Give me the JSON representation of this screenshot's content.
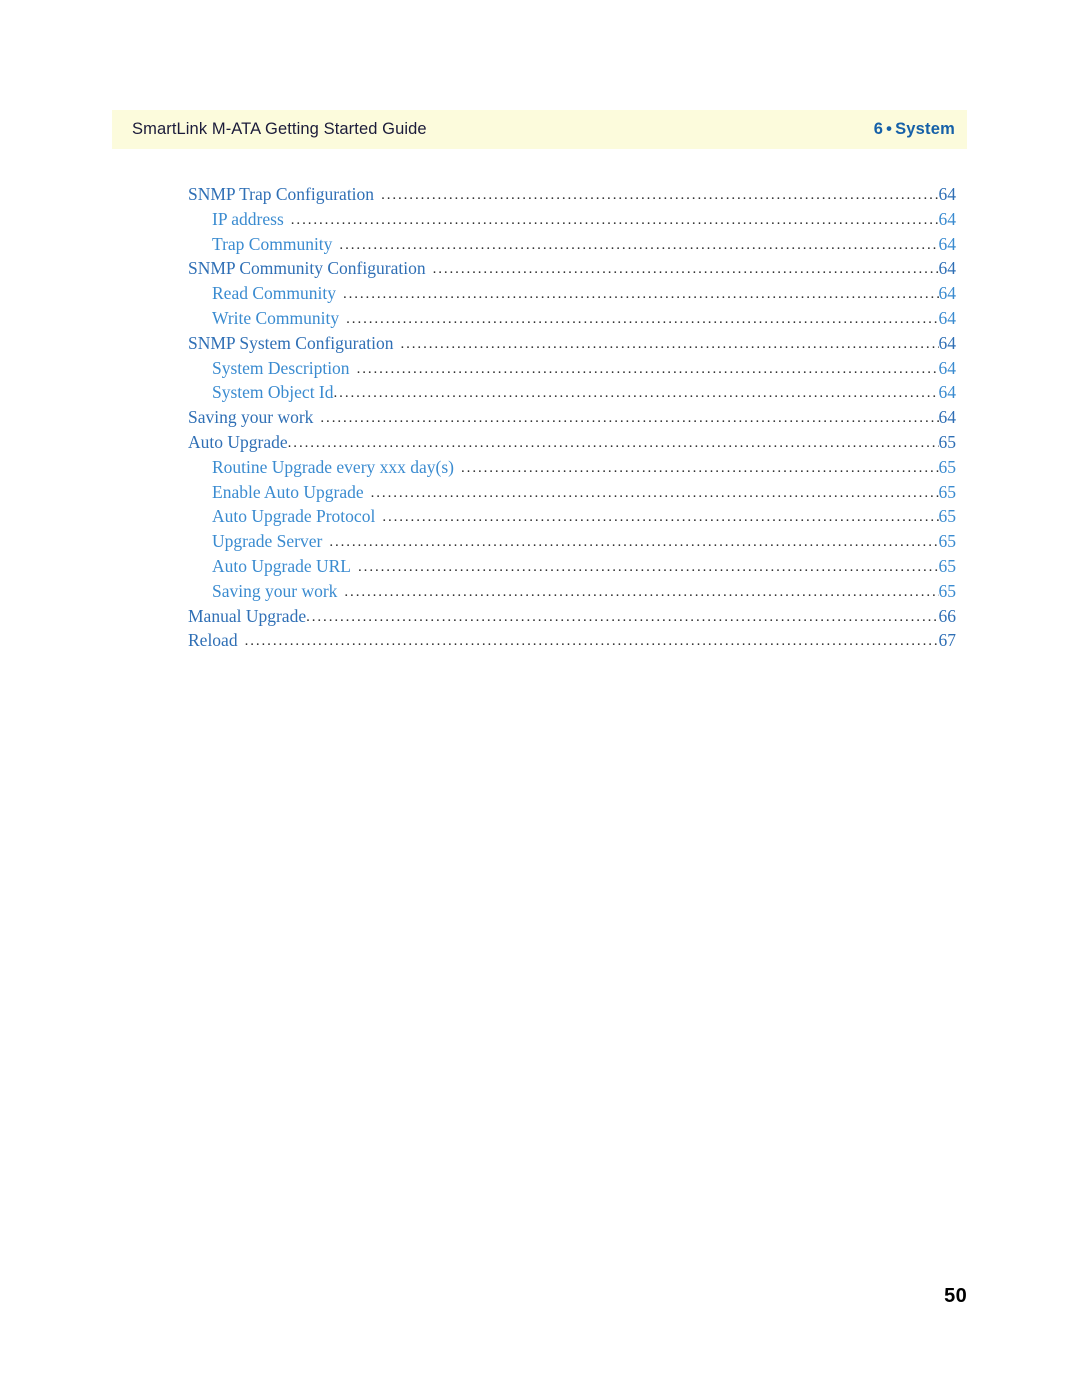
{
  "header": {
    "document_title": "SmartLink M-ATA Getting Started Guide",
    "chapter_number": "6",
    "separator": "•",
    "chapter_name": "System",
    "band_color": "#fcfbdc",
    "chapter_color": "#1560a8",
    "title_color": "#1b1b3a"
  },
  "toc": {
    "leader_color": "#2e2e2e",
    "level1_color": "#2f6fb5",
    "level2_color": "#3a8bd0",
    "entries": [
      {
        "label": "SNMP Trap Configuration",
        "page": "64",
        "level": 1,
        "gap": true
      },
      {
        "label": "IP address",
        "page": "64",
        "level": 2,
        "gap": true
      },
      {
        "label": "Trap Community",
        "page": "64",
        "level": 2,
        "gap": true
      },
      {
        "label": "SNMP Community Configuration",
        "page": "64",
        "level": 1,
        "gap": true
      },
      {
        "label": "Read Community",
        "page": "64",
        "level": 2,
        "gap": true
      },
      {
        "label": "Write Community",
        "page": "64",
        "level": 2,
        "gap": true
      },
      {
        "label": "SNMP System Configuration",
        "page": "64",
        "level": 1,
        "gap": true
      },
      {
        "label": "System Description",
        "page": "64",
        "level": 2,
        "gap": true
      },
      {
        "label": "System Object Id",
        "page": "64",
        "level": 2,
        "gap": false
      },
      {
        "label": "Saving your work",
        "page": "64",
        "level": 1,
        "gap": true
      },
      {
        "label": "Auto Upgrade",
        "page": "65",
        "level": 1,
        "gap": false
      },
      {
        "label": "Routine Upgrade every xxx day(s)",
        "page": "65",
        "level": 2,
        "gap": true
      },
      {
        "label": "Enable Auto Upgrade",
        "page": "65",
        "level": 2,
        "gap": true
      },
      {
        "label": "Auto Upgrade Protocol",
        "page": "65",
        "level": 2,
        "gap": true
      },
      {
        "label": "Upgrade Server",
        "page": "65",
        "level": 2,
        "gap": true
      },
      {
        "label": "Auto Upgrade URL",
        "page": "65",
        "level": 2,
        "gap": true
      },
      {
        "label": "Saving your work",
        "page": "65",
        "level": 2,
        "gap": true
      },
      {
        "label": "Manual Upgrade",
        "page": "66",
        "level": 1,
        "gap": false
      },
      {
        "label": "Reload",
        "page": "67",
        "level": 1,
        "gap": true
      }
    ]
  },
  "folio": {
    "page_number": "50"
  }
}
